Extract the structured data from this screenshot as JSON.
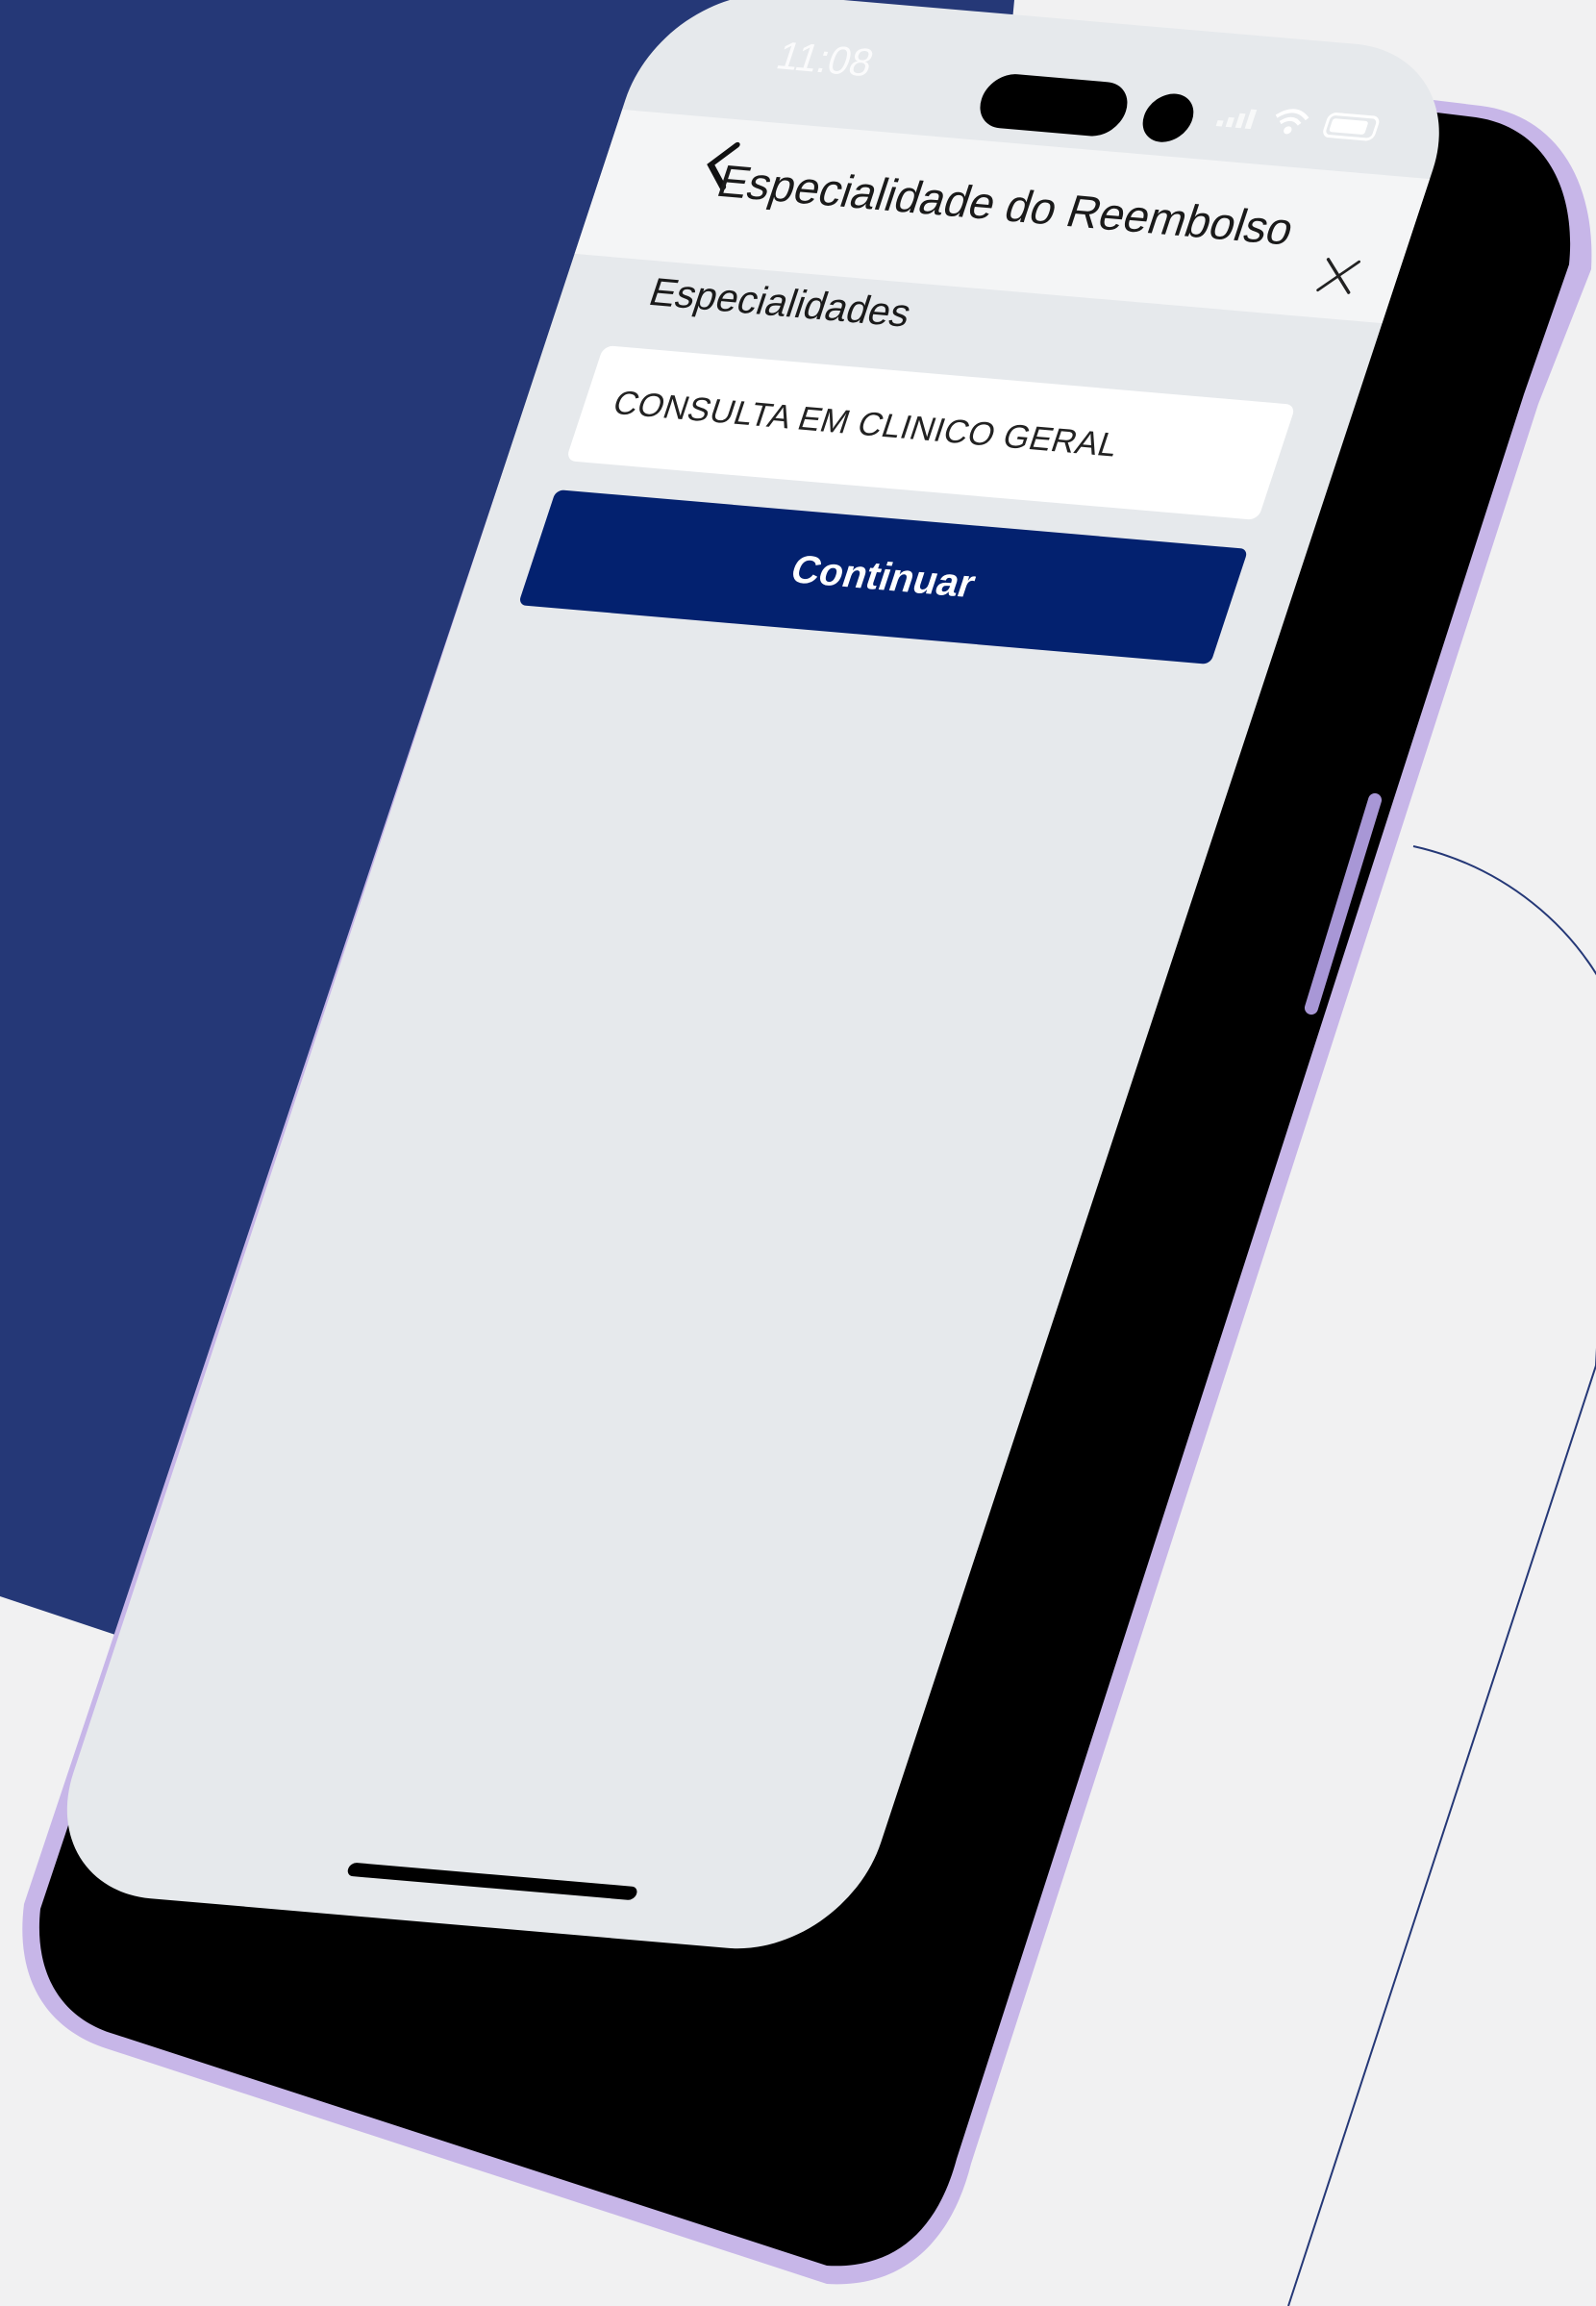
{
  "status_bar": {
    "time": "11:08"
  },
  "nav": {
    "back_icon": "chevron-left-icon",
    "title": "Especialidade do Reembolso",
    "close_icon": "close-icon"
  },
  "form": {
    "section_label": "Especialidades",
    "specialty_value": "CONSULTA EM CLINICO GERAL",
    "continue_label": "Continuar"
  },
  "colors": {
    "primary": "#03216f",
    "background_panel": "#253877",
    "screen_background": "#e6e9ec",
    "phone_frame": "#c7b6e8"
  }
}
